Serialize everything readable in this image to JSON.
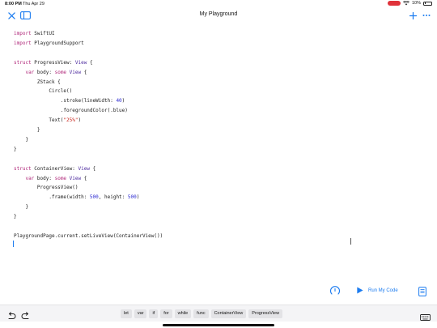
{
  "status": {
    "time": "8:00 PM",
    "date": "Thu Apr 29",
    "battery": "10%"
  },
  "nav": {
    "title": "My Playground"
  },
  "code": [
    [
      {
        "t": "import ",
        "c": "kw"
      },
      {
        "t": "SwiftUI",
        "c": ""
      }
    ],
    [
      {
        "t": "import ",
        "c": "kw"
      },
      {
        "t": "PlaygroundSupport",
        "c": ""
      }
    ],
    [],
    [
      {
        "t": "struct ",
        "c": "kw"
      },
      {
        "t": "ProgressView: ",
        "c": ""
      },
      {
        "t": "View",
        "c": "ty"
      },
      {
        "t": " {",
        "c": ""
      }
    ],
    [
      {
        "t": "    ",
        "c": ""
      },
      {
        "t": "var ",
        "c": "kw"
      },
      {
        "t": "body: ",
        "c": ""
      },
      {
        "t": "some ",
        "c": "kw"
      },
      {
        "t": "View",
        "c": "ty"
      },
      {
        "t": " {",
        "c": ""
      }
    ],
    [
      {
        "t": "        ZStack {",
        "c": ""
      }
    ],
    [
      {
        "t": "            Circle()",
        "c": ""
      }
    ],
    [
      {
        "t": "                .stroke(lineWidth: ",
        "c": ""
      },
      {
        "t": "40",
        "c": "num"
      },
      {
        "t": ")",
        "c": ""
      }
    ],
    [
      {
        "t": "                .foregroundColor(.blue)",
        "c": ""
      }
    ],
    [
      {
        "t": "            Text(",
        "c": ""
      },
      {
        "t": "\"25%\"",
        "c": "str"
      },
      {
        "t": ")",
        "c": ""
      }
    ],
    [
      {
        "t": "        }",
        "c": ""
      }
    ],
    [
      {
        "t": "    }",
        "c": ""
      }
    ],
    [
      {
        "t": "}",
        "c": ""
      }
    ],
    [],
    [
      {
        "t": "struct ",
        "c": "kw"
      },
      {
        "t": "ContainerView: ",
        "c": ""
      },
      {
        "t": "View",
        "c": "ty"
      },
      {
        "t": " {",
        "c": ""
      }
    ],
    [
      {
        "t": "    ",
        "c": ""
      },
      {
        "t": "var ",
        "c": "kw"
      },
      {
        "t": "body: ",
        "c": ""
      },
      {
        "t": "some ",
        "c": "kw"
      },
      {
        "t": "View",
        "c": "ty"
      },
      {
        "t": " {",
        "c": ""
      }
    ],
    [
      {
        "t": "        ProgressView()",
        "c": ""
      }
    ],
    [
      {
        "t": "            .frame(width: ",
        "c": ""
      },
      {
        "t": "500",
        "c": "num"
      },
      {
        "t": ", height: ",
        "c": ""
      },
      {
        "t": "500",
        "c": "num"
      },
      {
        "t": ")",
        "c": ""
      }
    ],
    [
      {
        "t": "    }",
        "c": ""
      }
    ],
    [
      {
        "t": "}",
        "c": ""
      }
    ],
    [],
    [
      {
        "t": "PlaygroundPage.current.setLiveView(ContainerView())",
        "c": ""
      }
    ]
  ],
  "run": {
    "label": "Run My Code"
  },
  "toolbar": {
    "keywords": [
      "let",
      "var",
      "if",
      "for",
      "while",
      "func",
      "ContainerView",
      "ProgressView"
    ]
  },
  "icons": {
    "close": "close-icon",
    "sidebar": "sidebar-icon",
    "add": "plus-icon",
    "more": "more-icon",
    "gauge": "gauge-icon",
    "run": "play-icon",
    "doc": "document-icon",
    "undo": "undo-icon",
    "redo": "redo-icon",
    "keyboard": "keyboard-icon"
  },
  "colors": {
    "accent": "#1c7cf0",
    "keyword": "#b0287a",
    "type": "#4c2a9e",
    "number": "#2c2ad1",
    "string": "#c8241c",
    "recording": "#e0323a"
  }
}
